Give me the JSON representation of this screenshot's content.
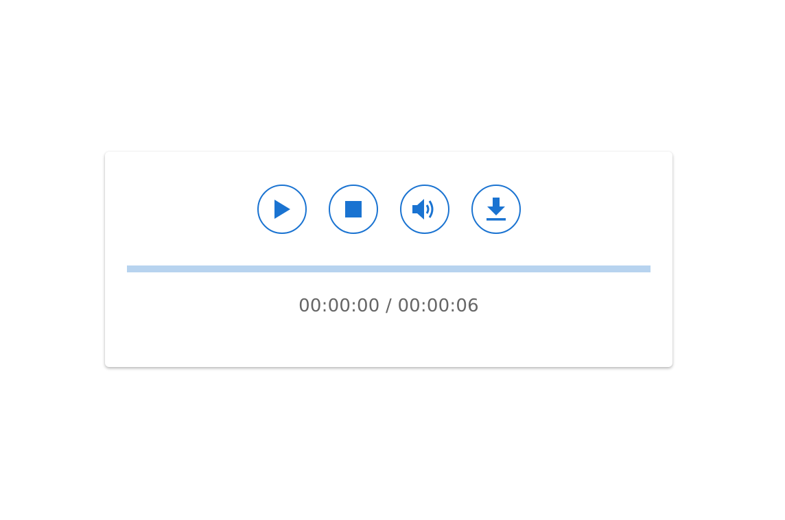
{
  "player": {
    "accent_color": "#1a73d1",
    "track_color": "#b7d3ef",
    "buttons": [
      {
        "name": "play",
        "icon": "play-icon"
      },
      {
        "name": "stop",
        "icon": "stop-icon"
      },
      {
        "name": "volume",
        "icon": "volume-icon"
      },
      {
        "name": "download",
        "icon": "download-icon"
      }
    ],
    "progress": 0,
    "time": {
      "current": "00:00:00",
      "separator": " / ",
      "total": "00:00:06"
    }
  }
}
